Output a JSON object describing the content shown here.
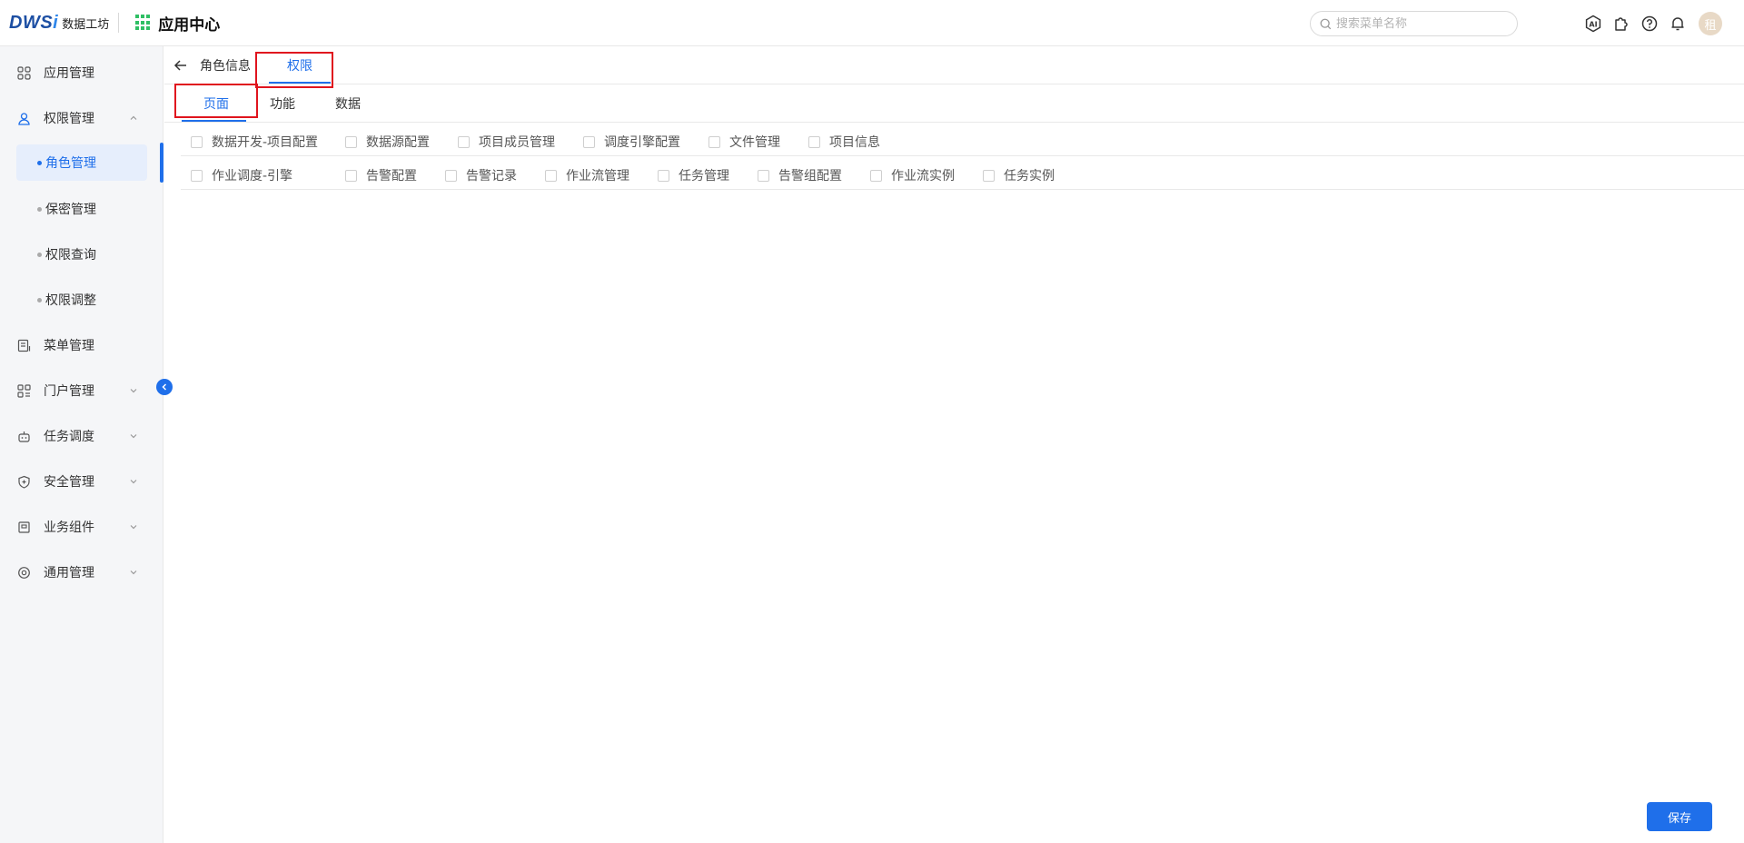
{
  "header": {
    "logo_mark": "DWS",
    "logo_i": "i",
    "logo_text": "数据工坊",
    "app_title": "应用中心",
    "search_placeholder": "搜索菜单名称",
    "avatar_text": "租"
  },
  "sidebar": {
    "items": [
      {
        "label": "应用管理",
        "icon": "apps-icon"
      },
      {
        "label": "权限管理",
        "icon": "user-icon",
        "expanded": true
      },
      {
        "label": "角色管理",
        "sub": true,
        "active": true
      },
      {
        "label": "保密管理",
        "sub": true
      },
      {
        "label": "权限查询",
        "sub": true
      },
      {
        "label": "权限调整",
        "sub": true
      },
      {
        "label": "菜单管理",
        "icon": "menu-doc-icon"
      },
      {
        "label": "门户管理",
        "icon": "portal-icon"
      },
      {
        "label": "任务调度",
        "icon": "robot-icon"
      },
      {
        "label": "安全管理",
        "icon": "shield-icon"
      },
      {
        "label": "业务组件",
        "icon": "component-icon"
      },
      {
        "label": "通用管理",
        "icon": "settings-icon"
      }
    ]
  },
  "content": {
    "top_tabs": [
      {
        "label": "角色信息",
        "active": false
      },
      {
        "label": "权限",
        "active": true
      }
    ],
    "sub_tabs": [
      {
        "label": "页面",
        "active": true
      },
      {
        "label": "功能",
        "active": false
      },
      {
        "label": "数据",
        "active": false
      }
    ],
    "row1": [
      "数据开发-项目配置",
      "数据源配置",
      "项目成员管理",
      "调度引擎配置",
      "文件管理",
      "项目信息"
    ],
    "row2": [
      "作业调度-引擎",
      "告警配置",
      "告警记录",
      "作业流管理",
      "任务管理",
      "告警组配置",
      "作业流实例",
      "任务实例"
    ],
    "save_label": "保存"
  },
  "colors": {
    "accent": "#1f6fea",
    "highlight_box": "#e0141e"
  }
}
